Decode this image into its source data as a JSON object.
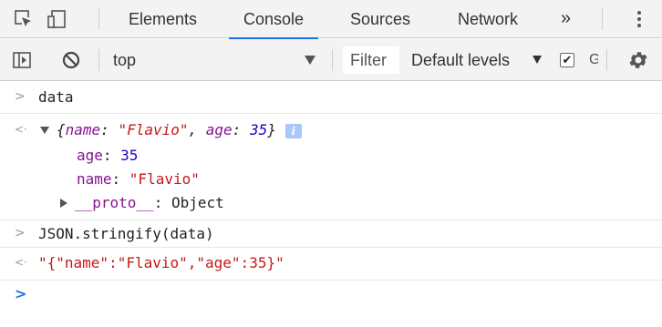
{
  "tabs": {
    "items": [
      {
        "label": "Elements"
      },
      {
        "label": "Console"
      },
      {
        "label": "Sources"
      },
      {
        "label": "Network"
      }
    ],
    "more": "»"
  },
  "toolbar": {
    "context": "top",
    "filter_placeholder": "Filter",
    "levels": "Default levels",
    "checkbox_label": "G"
  },
  "console": {
    "line1": {
      "input": "data"
    },
    "line2": {
      "brace_open": "{",
      "k1": "name",
      "v1": "\"Flavio\"",
      "k2": "age",
      "v2": "35",
      "brace_close": "}",
      "info": "i"
    },
    "prop_age": {
      "key": "age",
      "value": "35"
    },
    "prop_name": {
      "key": "name",
      "value": "\"Flavio\""
    },
    "prop_proto": {
      "key": "__proto__",
      "value": "Object"
    },
    "line3": {
      "input": "JSON.stringify(data)"
    },
    "line4": {
      "output": "\"{\"name\":\"Flavio\",\"age\":35}\""
    }
  },
  "colors": {
    "accent": "#1a73e8",
    "key": "#881391",
    "string": "#c41a16",
    "number": "#1c00cf"
  }
}
